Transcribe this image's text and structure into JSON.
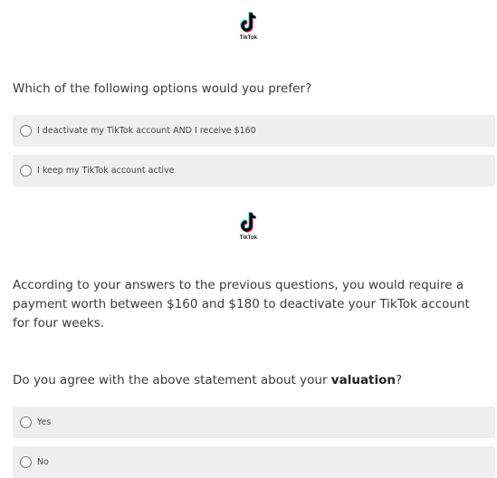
{
  "logo": {
    "wordmark": "TikTok",
    "icon": "tiktok-logo"
  },
  "question1": {
    "text": "Which of the following options would you prefer?",
    "options": [
      "I deactivate my TikTok account AND I receive $160",
      "I keep my TikTok account active"
    ]
  },
  "statement": "According to your answers to the previous questions, you would require a payment worth between $160 and $180 to deactivate your TikTok account for four weeks.",
  "question2": {
    "text_before": "Do you agree with the above statement about your ",
    "text_bold": "valuation",
    "text_after": "?",
    "options": [
      "Yes",
      "No"
    ]
  }
}
